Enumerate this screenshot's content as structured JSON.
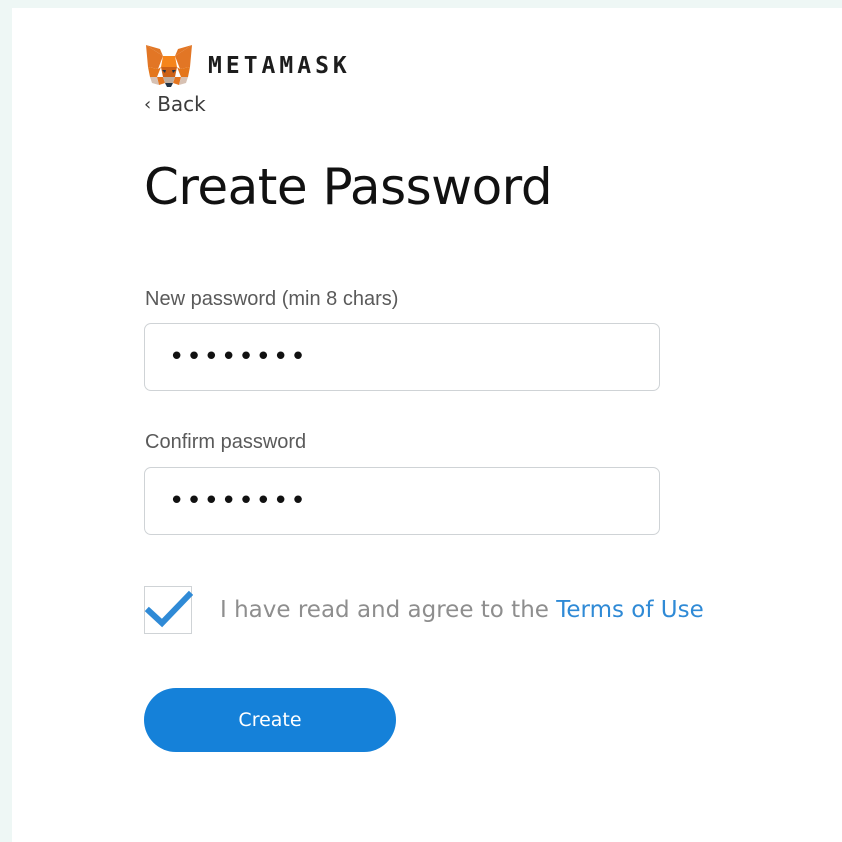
{
  "brand": {
    "logo_icon": "metamask-fox-icon",
    "wordmark": "METAMASK"
  },
  "nav": {
    "back_chevron": "‹",
    "back_label": "Back"
  },
  "page_title": "Create Password",
  "form": {
    "new_password_label": "New password (min 8 chars)",
    "new_password_value": "••••••••",
    "confirm_password_label": "Confirm password",
    "confirm_password_value": "••••••••",
    "terms_checked": true,
    "terms_text": "I have read and agree to the ",
    "terms_link": "Terms of Use",
    "create_label": "Create"
  },
  "colors": {
    "accent": "#1581d9",
    "link": "#2f8ad6",
    "checkmark": "#2f8ad6",
    "fox_orange": "#e2761b"
  }
}
